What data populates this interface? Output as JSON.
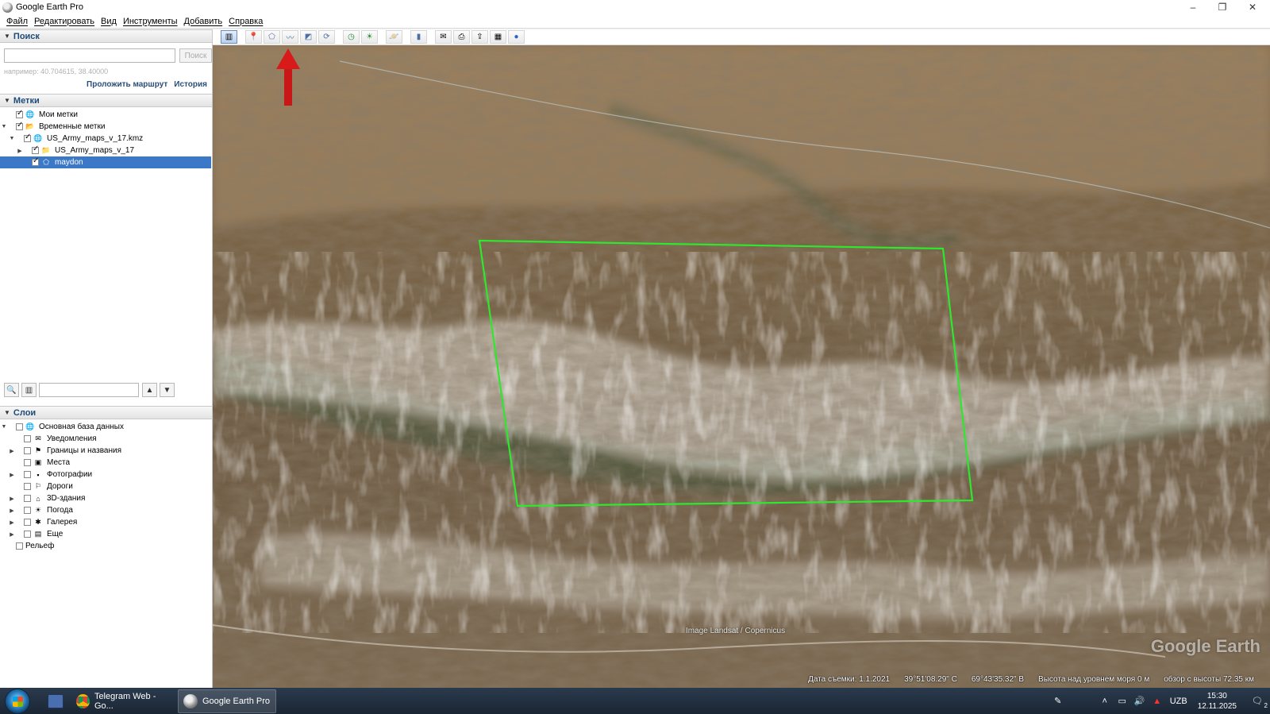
{
  "window": {
    "title": "Google Earth Pro",
    "minimize": "–",
    "restore": "❐",
    "close": "✕"
  },
  "menu": [
    "Файл",
    "Редактировать",
    "Вид",
    "Инструменты",
    "Добавить",
    "Справка"
  ],
  "search": {
    "header": "Поиск",
    "placeholder": "",
    "button": "Поиск",
    "hint": "например: 40.704615, 38.40000",
    "route_link": "Проложить маршрут",
    "history_link": "История"
  },
  "places": {
    "header": "Метки",
    "items": [
      {
        "label": "Мои метки",
        "checked": true,
        "icon": "globe-icon"
      },
      {
        "label": "Временные метки",
        "checked": true,
        "icon": "folder-icon"
      },
      {
        "label": "US_Army_maps_v_17.kmz",
        "checked": true,
        "icon": "globe-icon"
      },
      {
        "label": "US_Army_maps_v_17",
        "checked": true,
        "icon": "folder-icon"
      },
      {
        "label": "maydon",
        "checked": true,
        "icon": "polygon-icon",
        "selected": true
      }
    ]
  },
  "layers": {
    "header": "Слои",
    "items": [
      {
        "label": "Основная база данных",
        "icon": "database-icon"
      },
      {
        "label": "Уведомления",
        "icon": "mail-icon"
      },
      {
        "label": "Границы и названия",
        "icon": "flag-icon"
      },
      {
        "label": "Места",
        "icon": "place-icon"
      },
      {
        "label": "Фотографии",
        "icon": "photo-icon"
      },
      {
        "label": "Дороги",
        "icon": "road-icon"
      },
      {
        "label": "3D-здания",
        "icon": "building-icon"
      },
      {
        "label": "Погода",
        "icon": "weather-icon"
      },
      {
        "label": "Галерея",
        "icon": "gallery-icon"
      },
      {
        "label": "Еще",
        "icon": "more-icon"
      },
      {
        "label": "Рельеф",
        "icon": ""
      }
    ]
  },
  "map": {
    "attribution": "Image Landsat / Copernicus",
    "watermark": "Google Earth",
    "status": {
      "date": "Дата съемки: 1.1.2021",
      "lat": "39°51'08.29\" С",
      "lon": "69°43'35.32\" В",
      "elevation": "Высота над уровнем моря 0 м",
      "eye_alt": "обзор с высоты 72.35 км"
    },
    "polygon_color": "#2ee82e",
    "arrow_color": "#d01010"
  },
  "taskbar": {
    "apps": [
      {
        "label": "Telegram Web - Go...",
        "icon": "chrome-icon"
      },
      {
        "label": "Google Earth Pro",
        "icon": "google-earth-icon",
        "active": true
      }
    ],
    "lang": "UZB",
    "time": "15:30",
    "date": "12.11.2025",
    "notifications": "2"
  }
}
